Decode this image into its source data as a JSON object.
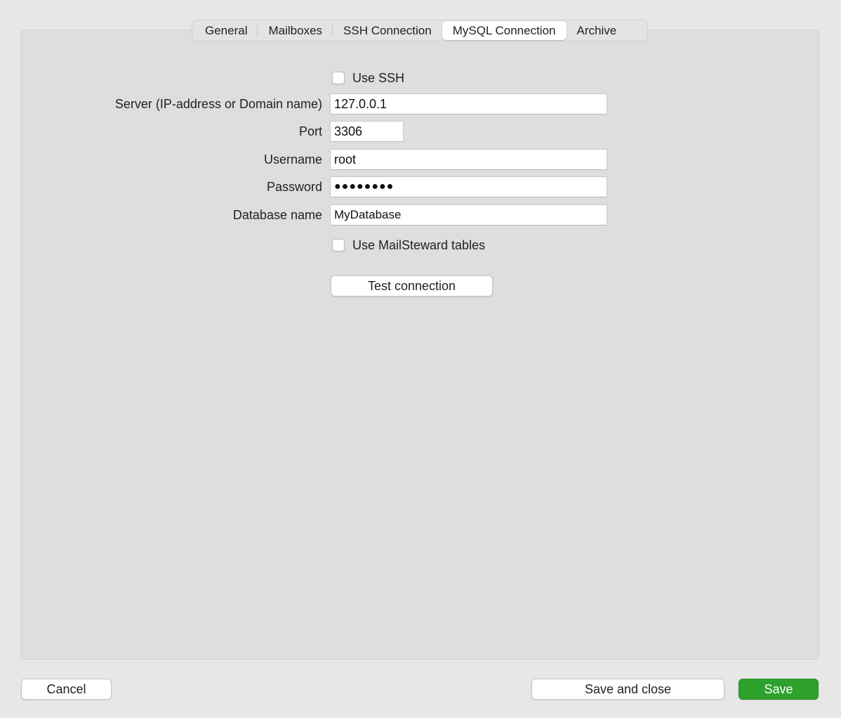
{
  "tabs": [
    {
      "label": "General",
      "active": false
    },
    {
      "label": "Mailboxes",
      "active": false
    },
    {
      "label": "SSH Connection",
      "active": false
    },
    {
      "label": "MySQL Connection",
      "active": true
    },
    {
      "label": "Archive",
      "active": false
    }
  ],
  "form": {
    "use_ssh": {
      "label": "Use SSH",
      "checked": false
    },
    "server": {
      "label": "Server (IP-address or Domain name)",
      "value": "127.0.0.1"
    },
    "port": {
      "label": "Port",
      "value": "3306"
    },
    "username": {
      "label": "Username",
      "value": "root"
    },
    "password": {
      "label": "Password",
      "value": "●●●●●●●●"
    },
    "database": {
      "label": "Database name",
      "value": "MyDatabase"
    },
    "use_mailsteward_tables": {
      "label": "Use MailSteward tables",
      "checked": false
    },
    "test_button": "Test connection"
  },
  "footer": {
    "cancel": "Cancel",
    "save_and_close": "Save and close",
    "save": "Save"
  },
  "colors": {
    "accent": "#2ea12c",
    "panel": "#dedede",
    "window": "#e7e7e7"
  }
}
